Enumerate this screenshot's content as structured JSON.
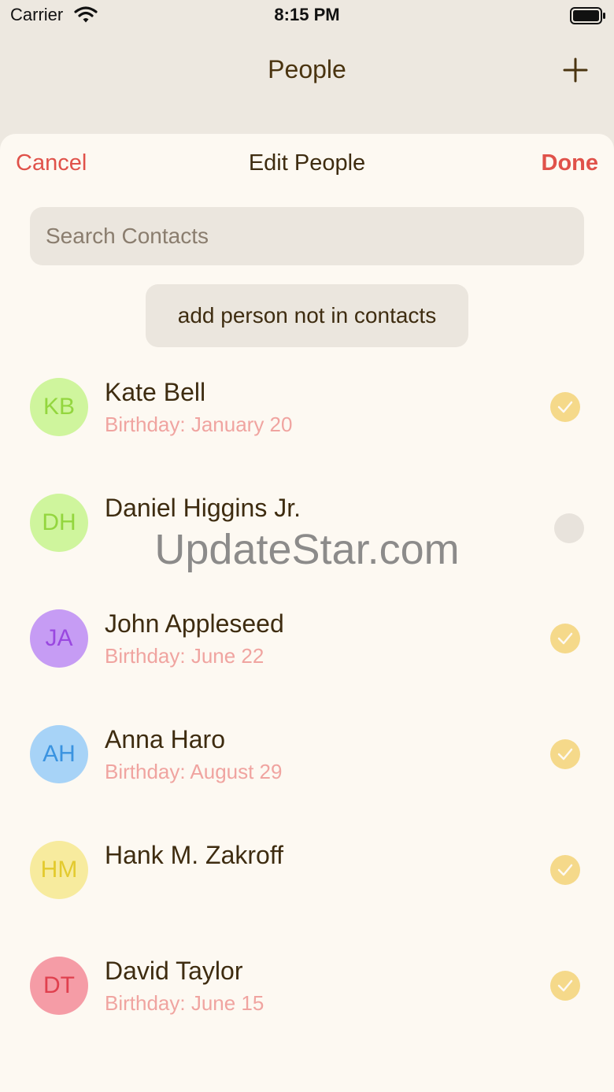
{
  "status_bar": {
    "carrier": "Carrier",
    "time": "8:15 PM"
  },
  "navbar": {
    "title": "People",
    "add_icon": "plus-icon"
  },
  "sheet": {
    "cancel_label": "Cancel",
    "title": "Edit People",
    "done_label": "Done",
    "search_placeholder": "Search Contacts",
    "add_person_label": "add person not in contacts"
  },
  "people": [
    {
      "initials": "KB",
      "name": "Kate Bell",
      "birthday": "Birthday: January 20",
      "selected": true,
      "avatar_bg": "#cff59d",
      "avatar_fg": "#93d63e"
    },
    {
      "initials": "DH",
      "name": "Daniel Higgins Jr.",
      "birthday": "",
      "selected": false,
      "avatar_bg": "#cff59d",
      "avatar_fg": "#93d63e"
    },
    {
      "initials": "JA",
      "name": "John Appleseed",
      "birthday": "Birthday: June 22",
      "selected": true,
      "avatar_bg": "#c69cf4",
      "avatar_fg": "#9a48e0"
    },
    {
      "initials": "AH",
      "name": "Anna Haro",
      "birthday": "Birthday: August 29",
      "selected": true,
      "avatar_bg": "#a7d3f7",
      "avatar_fg": "#3a93e0"
    },
    {
      "initials": "HM",
      "name": "Hank M. Zakroff",
      "birthday": "",
      "selected": true,
      "avatar_bg": "#f7eb9e",
      "avatar_fg": "#e3ca2e"
    },
    {
      "initials": "DT",
      "name": "David Taylor",
      "birthday": "Birthday: June 15",
      "selected": true,
      "avatar_bg": "#f59ca6",
      "avatar_fg": "#e0404e"
    }
  ],
  "watermark": "UpdateStar.com",
  "colors": {
    "accent": "#e0524a",
    "background": "#ede8e0",
    "sheet": "#fdf9f2",
    "check_selected": "#f5d98a",
    "check_unselected": "#e8e3dc",
    "birthday_text": "#f0a4a0"
  }
}
